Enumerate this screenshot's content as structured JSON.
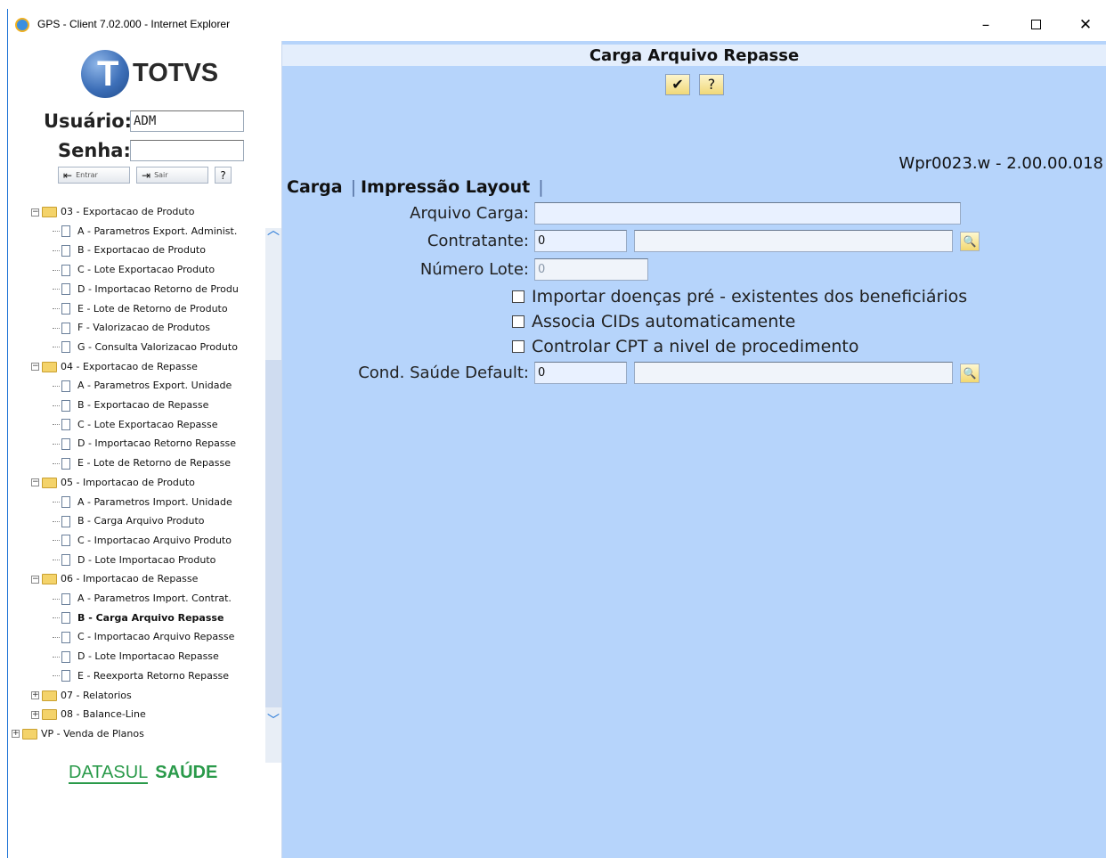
{
  "window": {
    "title": "GPS - Client 7.02.000 - Internet Explorer",
    "min_glyph": "–",
    "close_glyph": "✕"
  },
  "login": {
    "brand": "TOTVS",
    "brand_initial": "T",
    "user_label": "Usuário:",
    "user_value": "ADM",
    "password_label": "Senha:",
    "password_value": "",
    "enter_label": "Entrar",
    "exit_label": "Sair",
    "help_label": "?"
  },
  "tree": {
    "items": [
      {
        "label": "03 - Exportacao de Produto",
        "level": 0,
        "type": "folder"
      },
      {
        "label": "A - Parametros Export. Administ.",
        "level": 1,
        "type": "doc"
      },
      {
        "label": "B - Exportacao de Produto",
        "level": 1,
        "type": "doc"
      },
      {
        "label": "C - Lote Exportacao Produto",
        "level": 1,
        "type": "doc"
      },
      {
        "label": "D - Importacao Retorno de Produ",
        "level": 1,
        "type": "doc"
      },
      {
        "label": "E - Lote de Retorno de Produto",
        "level": 1,
        "type": "doc"
      },
      {
        "label": "F - Valorizacao de Produtos",
        "level": 1,
        "type": "doc"
      },
      {
        "label": "G - Consulta Valorizacao Produto",
        "level": 1,
        "type": "doc"
      },
      {
        "label": "04 - Exportacao de Repasse",
        "level": 0,
        "type": "folder"
      },
      {
        "label": "A - Parametros Export. Unidade",
        "level": 1,
        "type": "doc"
      },
      {
        "label": "B - Exportacao de Repasse",
        "level": 1,
        "type": "doc"
      },
      {
        "label": "C - Lote Exportacao Repasse",
        "level": 1,
        "type": "doc"
      },
      {
        "label": "D - Importacao Retorno Repasse",
        "level": 1,
        "type": "doc"
      },
      {
        "label": "E - Lote de Retorno de Repasse",
        "level": 1,
        "type": "doc"
      },
      {
        "label": "05 - Importacao de Produto",
        "level": 0,
        "type": "folder"
      },
      {
        "label": "A - Parametros Import. Unidade",
        "level": 1,
        "type": "doc"
      },
      {
        "label": "B - Carga Arquivo Produto",
        "level": 1,
        "type": "doc"
      },
      {
        "label": "C - Importacao Arquivo Produto",
        "level": 1,
        "type": "doc"
      },
      {
        "label": "D - Lote Importacao Produto",
        "level": 1,
        "type": "doc"
      },
      {
        "label": "06 - Importacao de Repasse",
        "level": 0,
        "type": "folder"
      },
      {
        "label": "A - Parametros Import. Contrat.",
        "level": 1,
        "type": "doc"
      },
      {
        "label": "B - Carga Arquivo Repasse",
        "level": 1,
        "type": "doc",
        "selected": true
      },
      {
        "label": "C - Importacao Arquivo Repasse",
        "level": 1,
        "type": "doc"
      },
      {
        "label": "D - Lote Importacao Repasse",
        "level": 1,
        "type": "doc"
      },
      {
        "label": "E - Reexporta Retorno Repasse",
        "level": 1,
        "type": "doc"
      },
      {
        "label": "07 - Relatorios",
        "level": 0,
        "type": "folder-closed"
      },
      {
        "label": "08 - Balance-Line",
        "level": 0,
        "type": "folder-closed"
      },
      {
        "label": "VP - Venda de Planos",
        "level": -1,
        "type": "folder-closed"
      }
    ]
  },
  "footer_brand": {
    "part1": "DATASUL",
    "part2": "SAÚDE",
    "color": "#2a9a4a"
  },
  "content": {
    "title": "Carga Arquivo Repasse",
    "ok_label": "✔",
    "help_label": "?",
    "program_id": "Wpr0023.w - 2.00.00.018",
    "tabs": [
      "Carga",
      "Impressão Layout"
    ],
    "fields": {
      "arquivo_carga_label": "Arquivo Carga:",
      "arquivo_carga_value": "",
      "contratante_label": "Contratante:",
      "contratante_code": "0",
      "contratante_name": "",
      "numero_lote_label": "Número Lote:",
      "numero_lote_value": "0",
      "cond_saude_label": "Cond. Saúde Default:",
      "cond_saude_code": "0",
      "cond_saude_name": ""
    },
    "checkboxes": [
      "Importar doenças pré - existentes dos beneficiários",
      "Associa CIDs automaticamente",
      "Controlar CPT a nivel de procedimento"
    ]
  },
  "colors": {
    "content_bg": "#b6d4fb",
    "header_bg": "#e4eefc",
    "window_border": "#1e73d6"
  }
}
